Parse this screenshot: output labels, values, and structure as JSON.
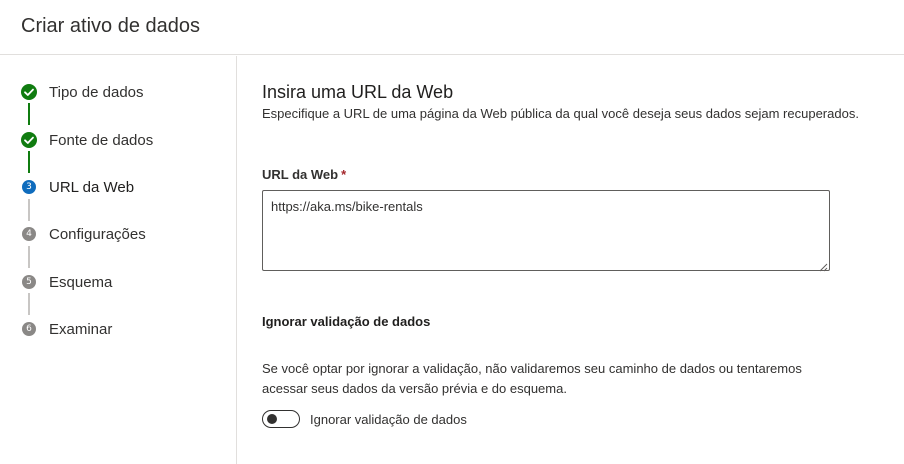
{
  "header": {
    "title": "Criar ativo de dados"
  },
  "steps": [
    {
      "label": "Tipo de dados",
      "status": "completed",
      "number": "1"
    },
    {
      "label": "Fonte de dados",
      "status": "completed",
      "number": "2"
    },
    {
      "label": "URL da Web",
      "status": "current",
      "number": "3"
    },
    {
      "label": "Configurações",
      "status": "pending",
      "number": "4"
    },
    {
      "label": "Esquema",
      "status": "pending",
      "number": "5"
    },
    {
      "label": "Examinar",
      "status": "pending",
      "number": "6"
    }
  ],
  "main": {
    "title": "Insira uma URL da Web",
    "description": "Especifique a URL de uma página da Web pública da qual você deseja seus dados sejam recuperados.",
    "url_field": {
      "label": "URL da Web",
      "required_marker": "*",
      "value": "https://aka.ms/bike-rentals"
    },
    "skip_validation": {
      "heading": "Ignorar validação de dados",
      "description": "Se você optar por ignorar a validação, não validaremos seu caminho de dados ou tentaremos acessar seus dados da versão prévia e do esquema.",
      "toggle_label": "Ignorar validação de dados",
      "toggle_on": false
    }
  },
  "colors": {
    "completed": "#107c10",
    "current": "#0f6cbd",
    "pending": "#8a8886",
    "connector_done": "#107c10",
    "connector_pending": "#c8c6c4",
    "required": "#a4262c"
  },
  "icons": {
    "completed": "checkmark-circle-icon",
    "current": "step-number-icon",
    "pending": "step-number-icon"
  }
}
